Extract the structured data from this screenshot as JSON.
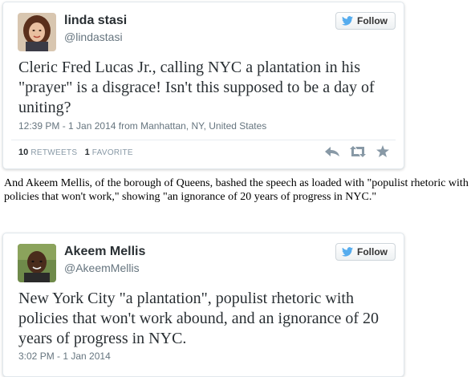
{
  "colors": {
    "twitter_blue": "#55acee",
    "text": "#292f33",
    "muted": "#66757f"
  },
  "tweets": [
    {
      "name": "linda stasi",
      "handle": "@lindastasi",
      "follow_label": "Follow",
      "text": "Cleric Fred Lucas Jr., calling NYC a plantation in his \"prayer\"  is a disgrace! Isn't this supposed to be a day of uniting?",
      "timestamp": "12:39 PM - 1 Jan 2014 from Manhattan, NY, United States",
      "retweets_count": "10",
      "retweets_label": "RETWEETS",
      "favorites_count": "1",
      "favorites_label": "FAVORITE"
    },
    {
      "name": "Akeem Mellis",
      "handle": "@AkeemMellis",
      "follow_label": "Follow",
      "text": "New York City \"a plantation\", populist rhetoric with policies that won't work abound, and an ignorance of 20 years of progress in NYC.",
      "timestamp": "3:02 PM - 1 Jan 2014"
    }
  ],
  "interstitial": "And Akeem Mellis, of the borough of Queens, bashed the speech as loaded with \"populist rhetoric with policies that won't work,\" showing \"an ignorance of 20 years of progress in NYC.\""
}
